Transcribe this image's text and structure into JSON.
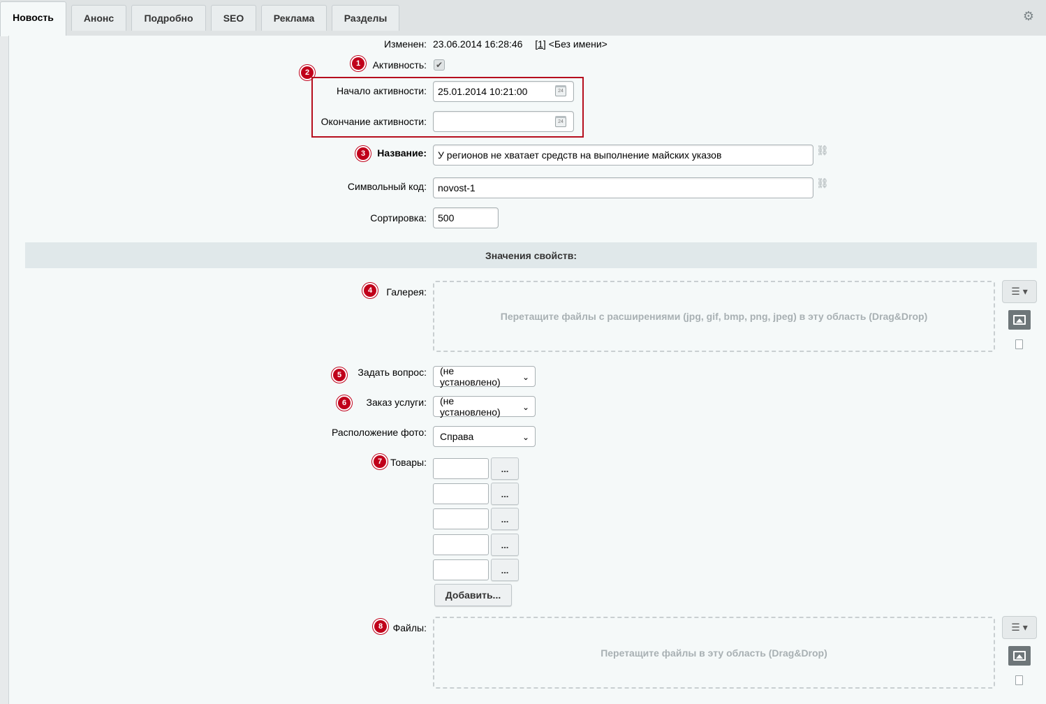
{
  "tabs": [
    {
      "label": "Новость",
      "active": true
    },
    {
      "label": "Анонс"
    },
    {
      "label": "Подробно"
    },
    {
      "label": "SEO"
    },
    {
      "label": "Реклама"
    },
    {
      "label": "Разделы"
    }
  ],
  "icons": {
    "settings": "gear-icon"
  },
  "form": {
    "modified": {
      "label": "Изменен:",
      "date": "23.06.2014 16:28:46",
      "user_link": "[1]",
      "user_name": "<Без имени>"
    },
    "active": {
      "badge": "1",
      "label": "Активность:",
      "checked": true
    },
    "dates_badge": "2",
    "start": {
      "label": "Начало активности:",
      "value": "25.01.2014 10:21:00"
    },
    "end": {
      "label": "Окончание активности:",
      "value": ""
    },
    "calendar_icon_text": "24",
    "name": {
      "badge": "3",
      "label": "Название:",
      "value": "У регионов не хватает средств на выполнение майских указов"
    },
    "code": {
      "label": "Символьный код:",
      "value": "novost-1"
    },
    "sort": {
      "label": "Сортировка:",
      "value": "500"
    }
  },
  "properties": {
    "header": "Значения свойств:",
    "gallery": {
      "badge": "4",
      "label": "Галерея:",
      "dropzone": "Перетащите файлы с расширениями (jpg, gif, bmp, png, jpeg) в эту область (Drag&Drop)"
    },
    "question": {
      "badge": "5",
      "label": "Задать вопрос:",
      "value": "(не установлено)"
    },
    "order": {
      "badge": "6",
      "label": "Заказ услуги:",
      "value": "(не установлено)"
    },
    "photo_position": {
      "label": "Расположение фото:",
      "value": "Справа"
    },
    "goods": {
      "badge": "7",
      "label": "Товары:",
      "browse": "...",
      "add": "Добавить..."
    },
    "files": {
      "badge": "8",
      "label": "Файлы:",
      "dropzone": "Перетащите файлы в эту область (Drag&Drop)"
    }
  },
  "colors": {
    "badge": "#c0001a",
    "highlight_box": "#b60f1e"
  }
}
